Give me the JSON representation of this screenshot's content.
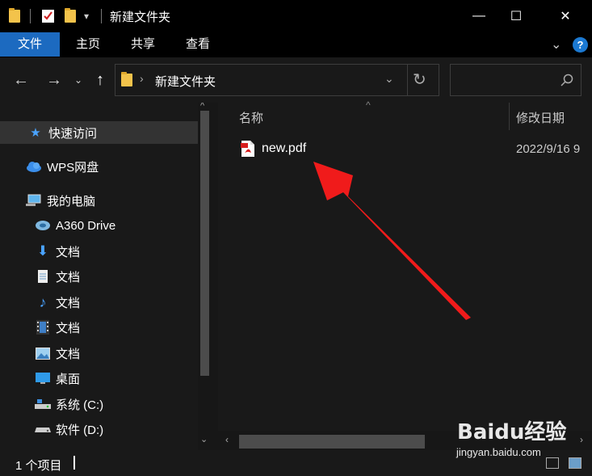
{
  "window": {
    "title": "新建文件夹",
    "minimize": "—",
    "maximize": "☐",
    "close": "✕"
  },
  "ribbon": {
    "tabs": [
      "文件",
      "主页",
      "共享",
      "查看"
    ],
    "active_tab": "文件",
    "help_label": "?",
    "accent": "#1c6ac0"
  },
  "address": {
    "path": "新建文件夹",
    "search_placeholder": ""
  },
  "sidebar": {
    "items": [
      {
        "label": "快速访问",
        "icon": "star-icon",
        "selected": true
      },
      {
        "label": "WPS网盘",
        "icon": "cloud-icon"
      },
      {
        "label": "我的电脑",
        "icon": "computer-icon"
      },
      {
        "label": "A360 Drive",
        "icon": "drive-icon"
      },
      {
        "label": "文档",
        "icon": "download-icon"
      },
      {
        "label": "文档",
        "icon": "document-icon"
      },
      {
        "label": "文档",
        "icon": "music-icon"
      },
      {
        "label": "文档",
        "icon": "video-icon"
      },
      {
        "label": "文档",
        "icon": "picture-icon"
      },
      {
        "label": "桌面",
        "icon": "desktop-icon"
      },
      {
        "label": "系统 (C:)",
        "icon": "disk-c-icon"
      },
      {
        "label": "软件 (D:)",
        "icon": "disk-d-icon"
      }
    ]
  },
  "columns": {
    "name": "名称",
    "date": "修改日期"
  },
  "files": [
    {
      "name": "new.pdf",
      "date": "2022/9/16 9",
      "icon": "pdf-icon"
    }
  ],
  "status": {
    "count": "1 个项目"
  },
  "watermark": {
    "brand": "Baidu经验",
    "url": "jingyan.baidu.com"
  },
  "annotation": {
    "arrow_color": "#f01b1b"
  }
}
